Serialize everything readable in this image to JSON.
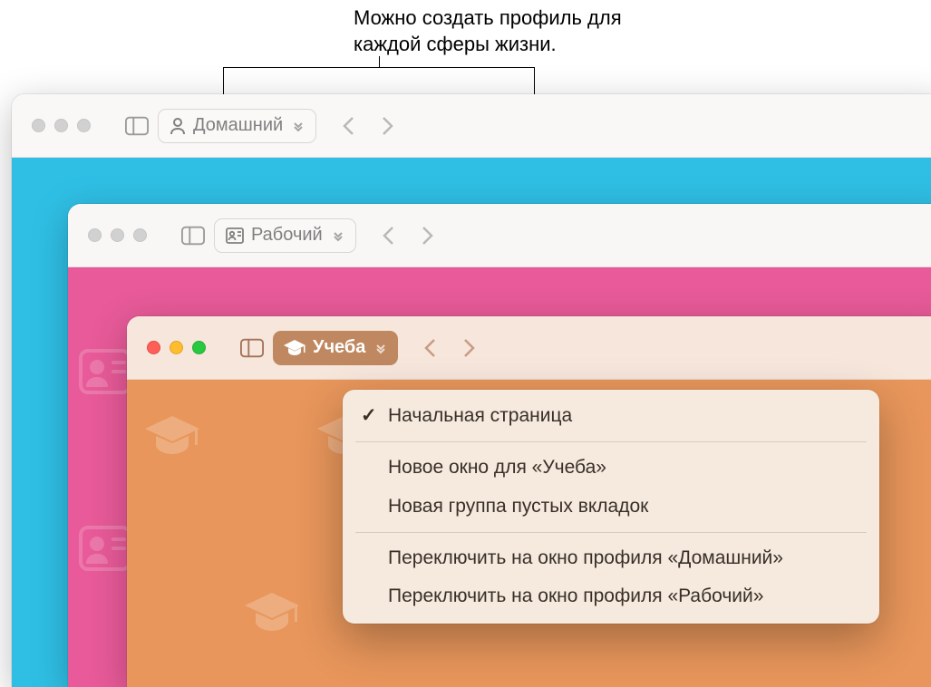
{
  "annotation": {
    "line1": "Можно создать профиль для",
    "line2": "каждой сферы жизни."
  },
  "windows": {
    "home": {
      "profile_label": "Домашний"
    },
    "work": {
      "profile_label": "Рабочий"
    },
    "study": {
      "profile_label": "Учеба"
    }
  },
  "menu": {
    "start_page": "Начальная страница",
    "new_window": "Новое окно для «Учеба»",
    "new_tabgroup": "Новая группа пустых вкладок",
    "switch_home": "Переключить на окно профиля «Домашний»",
    "switch_work": "Переключить на окно профиля «Рабочий»"
  }
}
